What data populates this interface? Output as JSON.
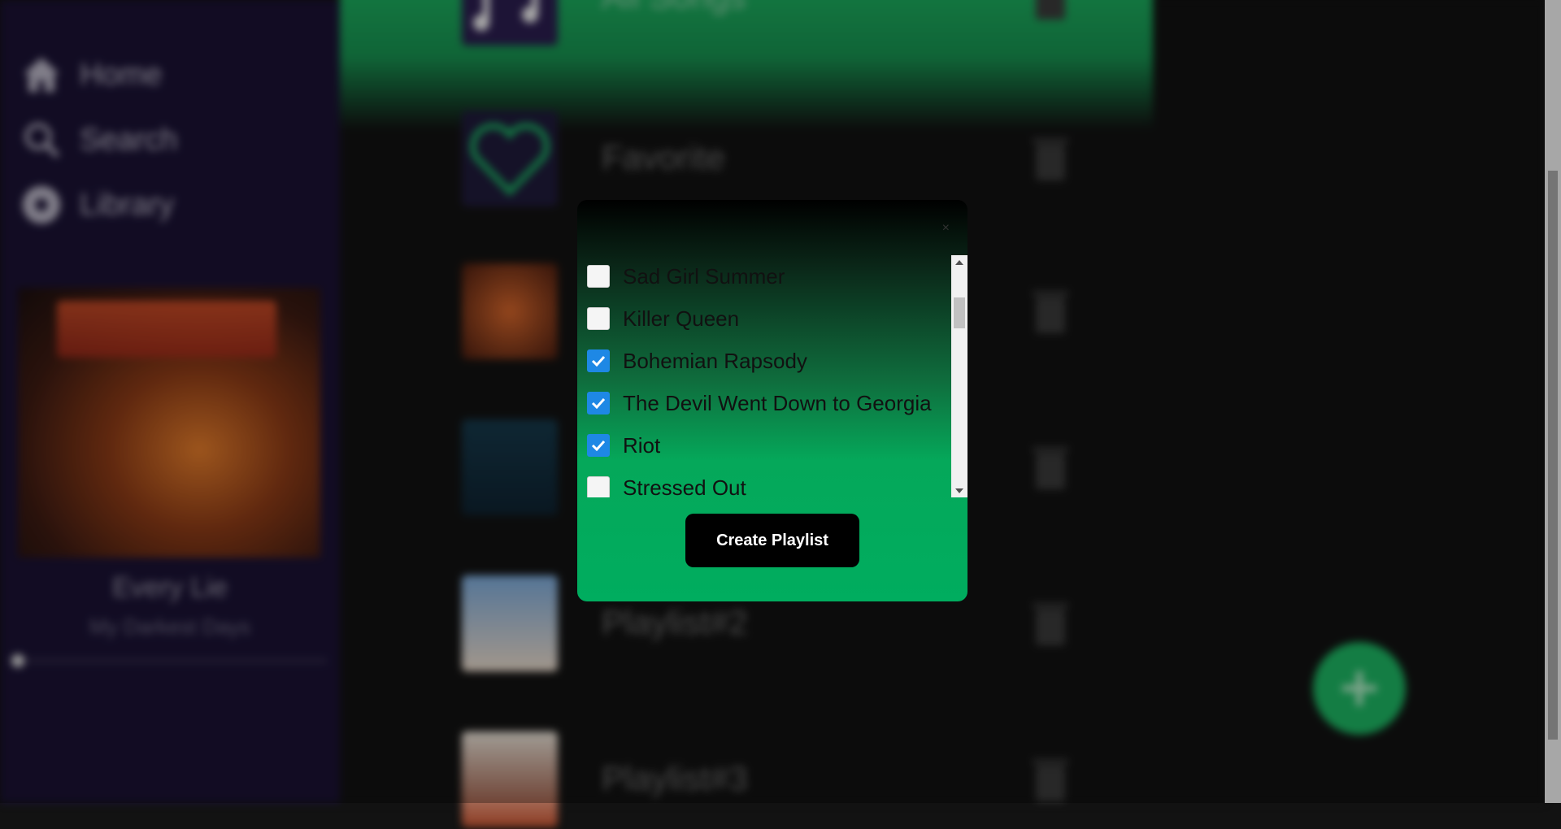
{
  "sidebar": {
    "nav": [
      {
        "label": "Home",
        "icon": "home-icon"
      },
      {
        "label": "Search",
        "icon": "search-icon"
      },
      {
        "label": "Library",
        "icon": "library-icon"
      }
    ],
    "now_playing": {
      "title": "Every Lie",
      "artist": "My Darkest Days",
      "progress": 0.0
    }
  },
  "playlists": [
    {
      "name": "All Songs",
      "thumb": "music-notes-icon"
    },
    {
      "name": "Favorite",
      "thumb": "heart-icon"
    },
    {
      "name": "",
      "thumb": "album-art"
    },
    {
      "name": "",
      "thumb": "album-art"
    },
    {
      "name": "Playlist#2",
      "thumb": "album-art"
    },
    {
      "name": "Playlist#3",
      "thumb": "album-art"
    }
  ],
  "modal": {
    "close_label": "×",
    "songs": [
      {
        "title": "Sad Girl Summer",
        "checked": false
      },
      {
        "title": "Killer Queen",
        "checked": false
      },
      {
        "title": "Bohemian Rapsody",
        "checked": true
      },
      {
        "title": "The Devil Went Down to Georgia",
        "checked": true
      },
      {
        "title": "Riot",
        "checked": true
      },
      {
        "title": "Stressed Out",
        "checked": false
      }
    ],
    "create_label": "Create Playlist"
  },
  "colors": {
    "accent": "#1db462",
    "sidebar_bg": "#1a1233",
    "checkbox_checked": "#1e88e5"
  }
}
